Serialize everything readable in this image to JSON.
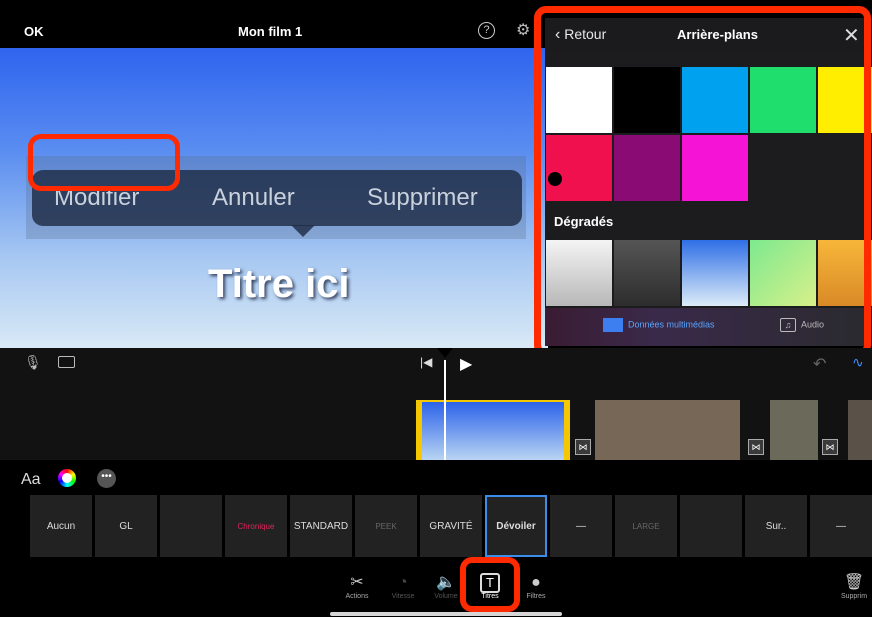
{
  "top_bar": {
    "ok": "OK",
    "title": "Mon film 1",
    "help": "?"
  },
  "viewer": {
    "context_menu": [
      "Modifier",
      "Annuler",
      "Supprimer"
    ],
    "title_text": "Titre ici"
  },
  "panel": {
    "back": "Retour",
    "title": "Arrière-plans",
    "close": "✕",
    "solid_colors": [
      "#ffffff",
      "#000000",
      "#00a2ef",
      "#1fde6e",
      "#ffee00",
      "#f0104d",
      "#8b0b74",
      "#f514d6"
    ],
    "gradients_label": "Dégradés",
    "gradients": [
      "linear-gradient(#f4f4f4, #b8b8b8)",
      "linear-gradient(#555555, #2d2d2d)",
      "linear-gradient(#2f6fe6, #ddecf8)",
      "linear-gradient(135deg, #7de98f, #d8f08a)",
      "linear-gradient(#f7b63a, #d98a26)"
    ],
    "tabs": {
      "media": "Données multimédias",
      "audio": "Audio"
    }
  },
  "timeline": {
    "clip_colors": [
      "#6c5f52",
      "#7a6b5c",
      "#5a5148"
    ]
  },
  "styles": {
    "aa": "Aa",
    "tiles": [
      "Aucun",
      "GL",
      "",
      "Chronique",
      "STANDARD",
      "PEEK",
      "GRAVITÉ",
      "Dévoiler",
      "—",
      "LARGE",
      "",
      "Sur..",
      "—"
    ]
  },
  "toolbar": {
    "actions": "Actions",
    "vitesse": "Vitesse",
    "volume": "Volume",
    "titres": "Titres",
    "filtres": "Filtres",
    "supprimer": "Supprim"
  },
  "colors": {
    "highlight": "#ff2a00",
    "selection_blue": "#3a8ee8",
    "clip_border": "#f5c700"
  }
}
